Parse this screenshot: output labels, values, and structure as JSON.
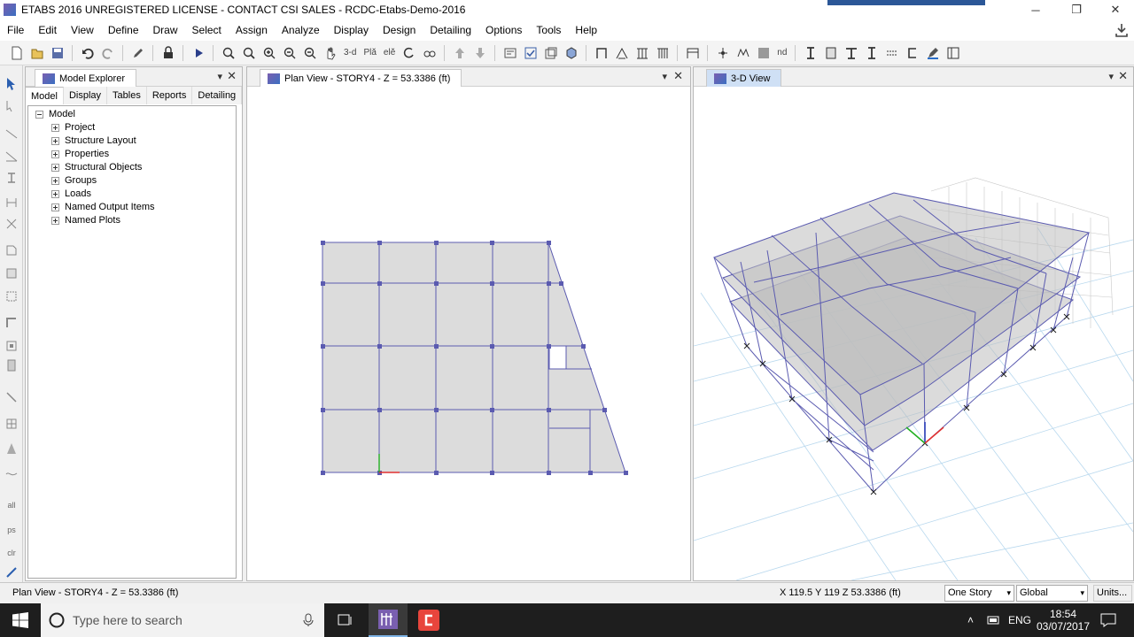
{
  "window": {
    "title": "ETABS 2016 UNREGISTERED LICENSE - CONTACT CSI SALES  -  RCDC-Etabs-Demo-2016",
    "minimize": "─",
    "restore": "❐",
    "close": "✕"
  },
  "menu": [
    "File",
    "Edit",
    "View",
    "Define",
    "Draw",
    "Select",
    "Assign",
    "Analyze",
    "Display",
    "Design",
    "Detailing",
    "Options",
    "Tools",
    "Help"
  ],
  "toolbar": {
    "view_3d": "3-d",
    "plan": "Plă",
    "elev": "elĕ",
    "nd": "nd"
  },
  "lefttools": {
    "all": "all",
    "ps": "ps",
    "clr": "clr"
  },
  "model_explorer": {
    "title": "Model Explorer",
    "tabs": [
      "Model",
      "Display",
      "Tables",
      "Reports",
      "Detailing"
    ],
    "active_tab": "Model",
    "root": "Model",
    "items": [
      "Project",
      "Structure Layout",
      "Properties",
      "Structural Objects",
      "Groups",
      "Loads",
      "Named Output Items",
      "Named Plots"
    ]
  },
  "plan_view": {
    "title": "Plan View - STORY4 - Z = 53.3386 (ft)"
  },
  "view_3d": {
    "title": "3-D View"
  },
  "status": {
    "left": "Plan View - STORY4 - Z = 53.3386 (ft)",
    "coords": "X 119.5  Y 119  Z 53.3386 (ft)",
    "story_select": "One Story",
    "coord_select": "Global",
    "units": "Units..."
  },
  "taskbar": {
    "search_placeholder": "Type here to search",
    "lang": "ENG",
    "time": "18:54",
    "date": "03/07/2017"
  },
  "colors": {
    "frame": "#5b5bb0",
    "slab": "#dcdcdc",
    "grid": "#b8d8ee",
    "axis_x": "#e03030",
    "axis_y": "#22b022"
  }
}
